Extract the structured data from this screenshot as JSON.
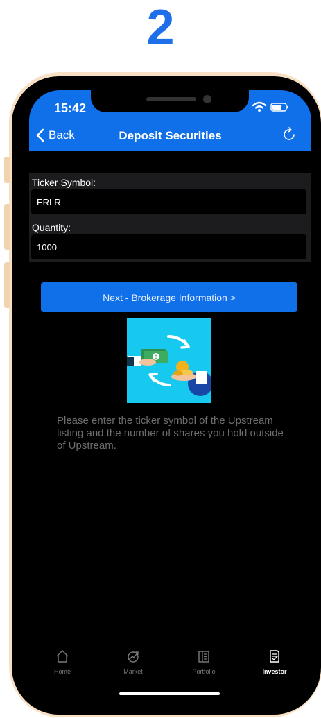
{
  "step": {
    "number": "2"
  },
  "status_bar": {
    "time": "15:42"
  },
  "nav": {
    "back_label": "Back",
    "title": "Deposit Securities"
  },
  "form": {
    "ticker_label": "Ticker Symbol:",
    "ticker_value": "ERLR",
    "quantity_label": "Quantity:",
    "quantity_value": "1000"
  },
  "next_button": {
    "label": "Next - Brokerage Information >"
  },
  "help_text": "Please enter the ticker symbol of the Upstream listing and the number of shares you hold outside of Upstream.",
  "tabs": [
    {
      "label": "Home",
      "icon": "home-icon",
      "active": false
    },
    {
      "label": "Market",
      "icon": "market-icon",
      "active": false
    },
    {
      "label": "Portfolio",
      "icon": "portfolio-icon",
      "active": false
    },
    {
      "label": "Investor",
      "icon": "investor-icon",
      "active": true
    }
  ],
  "colors": {
    "accent": "#0f70e9",
    "step_number": "#1f6fe8",
    "background": "#000000",
    "illustration_bg": "#17c9ee"
  }
}
